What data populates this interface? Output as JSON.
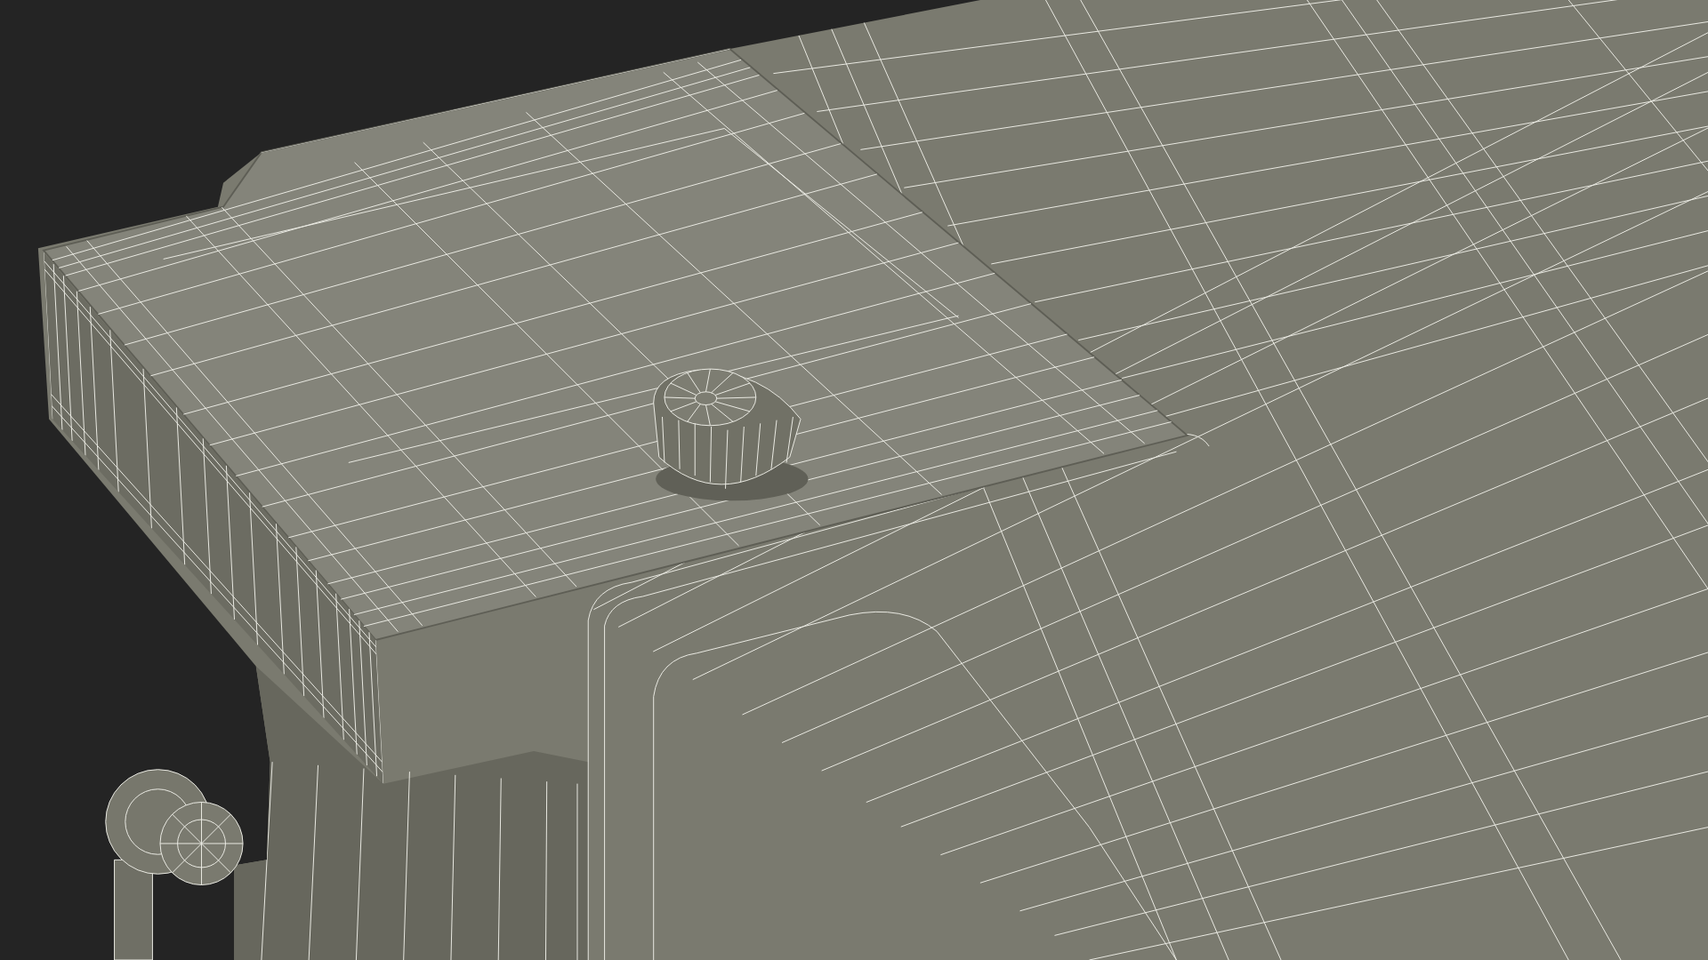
{
  "render": {
    "wireframe": true
  }
}
